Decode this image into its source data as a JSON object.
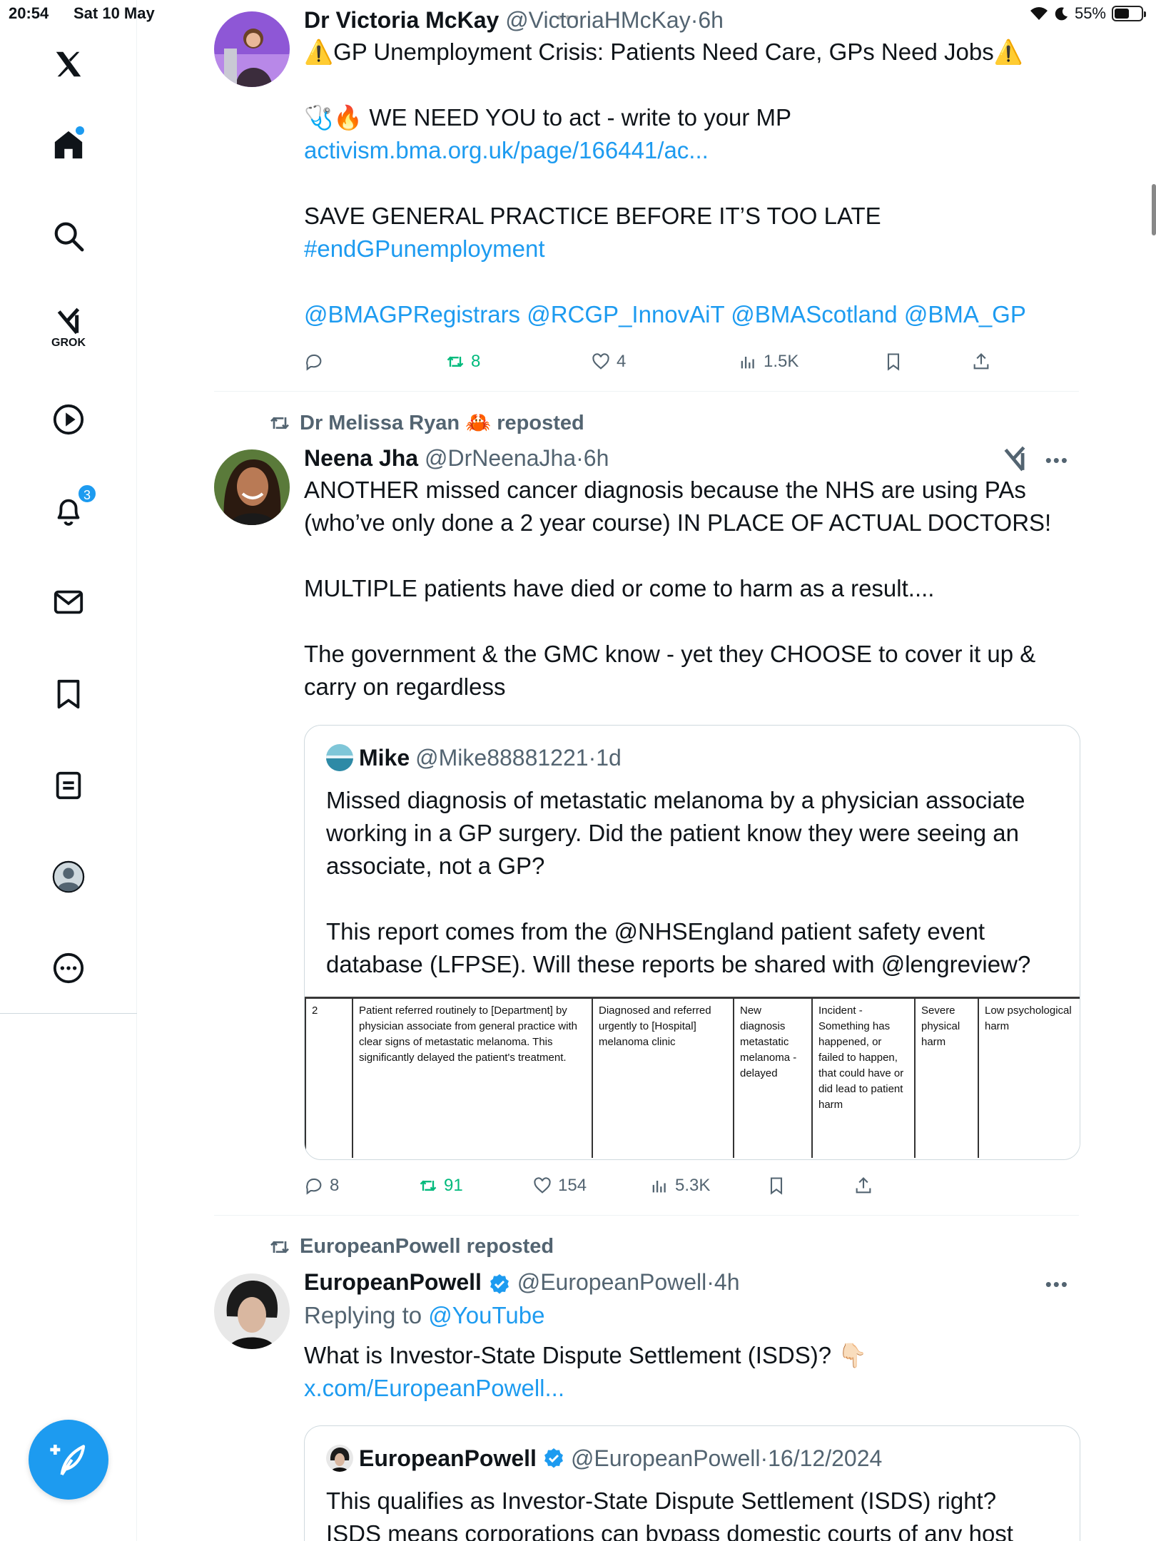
{
  "status_bar": {
    "time": "20:54",
    "date": "Sat 10 May",
    "battery": "55%",
    "battery_level": 0.55
  },
  "sidebar": {
    "items": [
      {
        "name": "logo",
        "icon": "x-logo"
      },
      {
        "name": "home",
        "icon": "home-icon"
      },
      {
        "name": "explore",
        "icon": "search-icon"
      },
      {
        "name": "grok",
        "icon": "grok-icon",
        "label": "GROK"
      },
      {
        "name": "video",
        "icon": "play-icon"
      },
      {
        "name": "notifications",
        "icon": "bell-icon",
        "badge": "3"
      },
      {
        "name": "messages",
        "icon": "mail-icon"
      },
      {
        "name": "bookmarks",
        "icon": "bookmark-icon"
      },
      {
        "name": "articles",
        "icon": "article-icon"
      },
      {
        "name": "profile",
        "icon": "profile-icon"
      },
      {
        "name": "more",
        "icon": "more-icon"
      }
    ],
    "compose_icon": "compose-icon"
  },
  "posts": [
    {
      "name": "Dr Victoria McKay",
      "handle": "@VictoriaHMcKay",
      "time": "6h",
      "lines": {
        "title": "⚠️GP Unemployment Crisis: Patients Need Care, GPs Need Jobs⚠️",
        "emoji": "🩺🔥",
        "act": " WE NEED YOU to act - write to your MP",
        "link": "activism.bma.org.uk/page/166441/ac...",
        "shout": "SAVE GENERAL PRACTICE BEFORE IT’S TOO LATE",
        "hashtag": "#endGPunemployment",
        "mentions": "@BMAGPRegistrars @RCGP_InnovAiT @BMAScotland @BMA_GP"
      },
      "stats": {
        "replies": "",
        "reposts": "8",
        "likes": "4",
        "views": "1.5K"
      }
    },
    {
      "repost_by": "Dr Melissa Ryan 🦀 reposted",
      "name": "Neena Jha",
      "handle": "@DrNeenaJha",
      "time": "6h",
      "lines": {
        "l1": "ANOTHER missed cancer diagnosis because the NHS are using PAs",
        "l2": "(who’ve only done a 2 year course) IN PLACE OF ACTUAL DOCTORS!",
        "l3": "MULTIPLE patients have died or come to harm as a result....",
        "l4": "The government & the GMC know - yet they CHOOSE to cover it up &",
        "l5": "carry on regardless"
      },
      "quote": {
        "name": "Mike",
        "handle": "@Mike88881221",
        "time": "1d",
        "l1": "Missed diagnosis of metastatic melanoma by a physician associate",
        "l2": "working in a GP surgery. Did the patient know they were seeing an",
        "l3": "associate, not a GP?",
        "l4": "This report comes from the @NHSEngland patient safety event",
        "l5": "database (LFPSE). Will these reports be shared with @lengreview?",
        "report": {
          "c1": "2",
          "c2": "Patient referred routinely to [Department] by physician associate from general practice with clear signs of metastatic melanoma. This significantly delayed the patient's treatment.",
          "c3": "Diagnosed and referred urgently to [Hospital] melanoma clinic",
          "c4": "New diagnosis metastatic melanoma - delayed",
          "c5": "Incident - Something has happened, or failed to happen, that could have or did lead to patient harm",
          "c6": "Severe physical harm",
          "c7": "Low psychological harm"
        }
      },
      "stats": {
        "replies": "8",
        "reposts": "91",
        "likes": "154",
        "views": "5.3K"
      }
    },
    {
      "repost_by": "EuropeanPowell reposted",
      "name": "EuropeanPowell",
      "handle": "@EuropeanPowell",
      "time": "4h",
      "replying_prefix": "Replying to ",
      "replying_to": "@YouTube",
      "l1": "What is Investor-State Dispute Settlement (ISDS)? 👇🏻",
      "link": "x.com/EuropeanPowell...",
      "quote": {
        "name": "EuropeanPowell",
        "handle": "@EuropeanPowell",
        "time": "16/12/2024",
        "l1": "This qualifies as Investor-State Dispute Settlement (ISDS) right?",
        "l2": "ISDS means corporations can bypass domestic courts of any host"
      }
    }
  ],
  "colors": {
    "accent": "#1d9bf0",
    "repost_green": "#00ba7c",
    "muted": "#536471"
  }
}
